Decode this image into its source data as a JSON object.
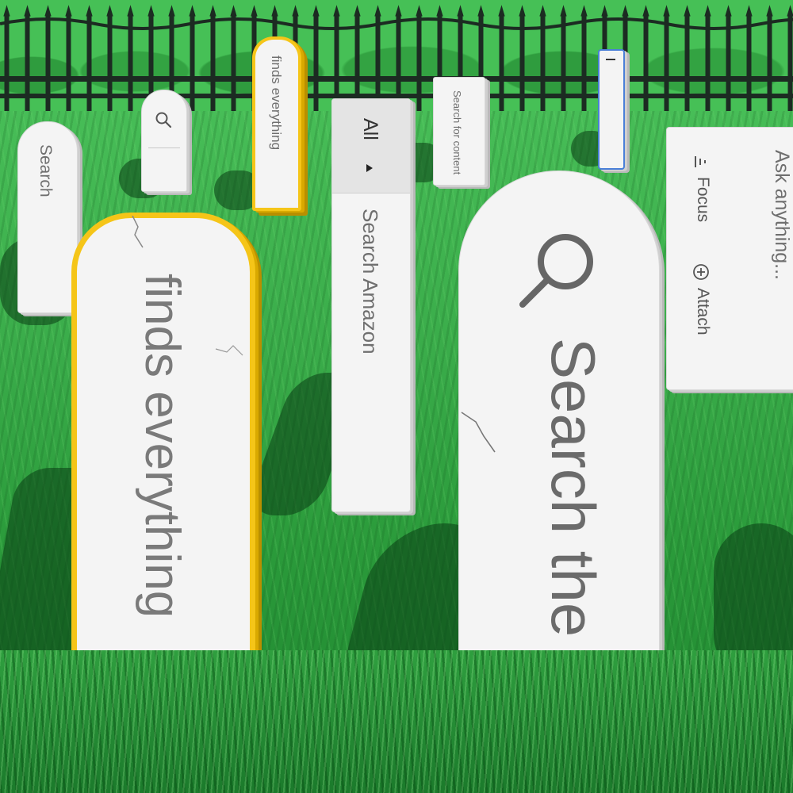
{
  "colors": {
    "grass": "#3aac4a",
    "stone": "#f4f4f4",
    "stone_text": "#6f6f6f",
    "yellow_border": "#f5c518",
    "blue_border": "#4a7fd8",
    "fence": "#1c2b22"
  },
  "stones": {
    "search_small": {
      "label": "Search"
    },
    "search_icon_small": {
      "icon": "search-icon"
    },
    "finds_small": {
      "label": "finds everything"
    },
    "amazon": {
      "scope": "All",
      "scope_icon": "dropdown-arrow-icon",
      "label": "Search Amazon"
    },
    "search_content": {
      "label": "Search for content"
    },
    "text_cursor": {
      "icon": "text-cursor-icon"
    },
    "ask": {
      "label": "Ask anything...",
      "focus_label": "Focus",
      "focus_icon": "filter-lines-icon",
      "attach_label": "Attach",
      "attach_icon": "plus-circle-icon"
    },
    "finds_big": {
      "label": "finds everything"
    },
    "web": {
      "icon": "search-icon",
      "label": "Search the web"
    }
  }
}
